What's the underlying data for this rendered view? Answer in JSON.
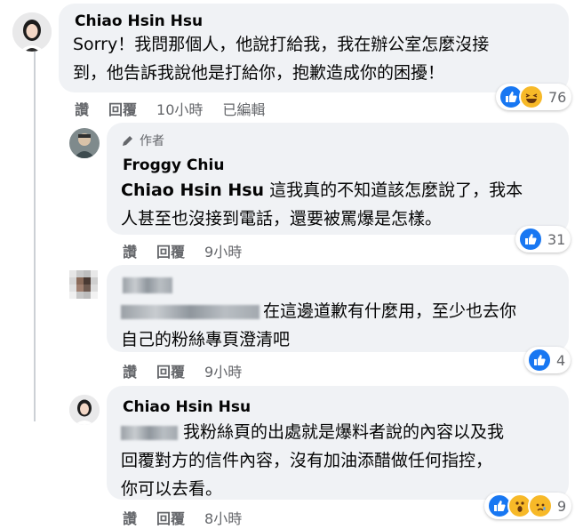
{
  "comments": [
    {
      "author": "Chiao Hsin Hsu",
      "text_line1": "Sorry！我問那個人，他說打給我，我在辦公室怎麼沒接",
      "text_line2": "到，他告訴我說他是打給你，抱歉造成你的困擾！",
      "actions": {
        "like": "讚",
        "reply": "回覆",
        "time": "10小時",
        "edited": "已編輯"
      },
      "reactions": {
        "icons": [
          "like-icon",
          "haha-icon"
        ],
        "count": "76"
      }
    },
    {
      "badge": "作者",
      "author": "Froggy Chiu",
      "tag": "Chiao Hsin Hsu",
      "text_line1_rest": " 這我真的不知道該怎麼說了，我本",
      "text_line2": "人甚至也沒接到電話，還要被罵爆是怎樣。",
      "actions": {
        "like": "讚",
        "reply": "回覆",
        "time": "9小時"
      },
      "reactions": {
        "icons": [
          "like-icon"
        ],
        "count": "31"
      }
    },
    {
      "author": "",
      "text_line1_rest": "在這邊道歉有什麼用，至少也去你",
      "text_line2": "自己的粉絲專頁澄清吧",
      "actions": {
        "like": "讚",
        "reply": "回覆",
        "time": "9小時"
      },
      "reactions": {
        "icons": [
          "like-icon"
        ],
        "count": "4"
      }
    },
    {
      "author": "Chiao Hsin Hsu",
      "text_line1_rest": " 我粉絲頁的出處就是爆料者說的內容以及我",
      "text_line2": "回覆對方的信件內容，沒有加油添醋做任何指控，",
      "text_line3": "你可以去看。",
      "actions": {
        "like": "讚",
        "reply": "回覆",
        "time": "8小時"
      },
      "reactions": {
        "icons": [
          "like-icon",
          "wow-icon",
          "sad-icon"
        ],
        "count": "9"
      }
    }
  ],
  "colors": {
    "like": "#1877f2",
    "bubble": "#f0f2f5",
    "meta": "#65676b",
    "haha": "#f7b928"
  }
}
